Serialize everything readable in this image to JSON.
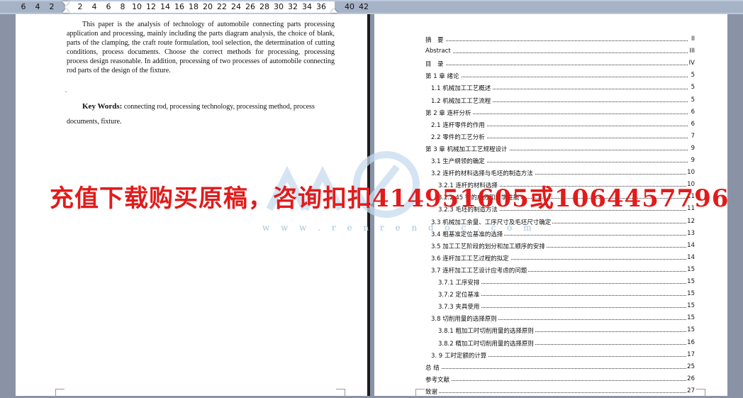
{
  "ruler": {
    "ticks": [
      "6",
      "4",
      "2",
      "2",
      "4",
      "6",
      "8",
      "10",
      "12",
      "14",
      "16",
      "18",
      "20",
      "22",
      "24",
      "26",
      "28",
      "30",
      "32",
      "34",
      "36",
      "40",
      "42"
    ]
  },
  "left_page": {
    "abstract_text": "This paper is the analysis of technology of automobile connecting parts processing application and processing, mainly including the parts diagram analysis, the choice of blank, parts of the clamping, the craft route formulation, tool selection, the determination of cutting conditions, process documents. Choose the correct methods for processing, processing process design reasonable. In addition, processing of two processes of automobile connecting rod parts of the design of the fixture.",
    "para_mark": ".",
    "keywords_label": "Key Words:",
    "keywords_text": "connecting rod, processing technology, processing method, process documents, fixture."
  },
  "toc": [
    {
      "label": "摘　要",
      "page": "II"
    },
    {
      "label": "Abstract",
      "page": "III"
    },
    {
      "label": "目　录",
      "page": "IV"
    },
    {
      "label": "第 1 章  绪论",
      "page": "5"
    },
    {
      "label": "1.1  机械加工工艺概述",
      "page": "5"
    },
    {
      "label": "1.2 机械加工工艺流程",
      "page": "5"
    },
    {
      "label": "第 2 章  连杆分析",
      "page": "6"
    },
    {
      "label": "2.1  连杆零件的作用",
      "page": "6"
    },
    {
      "label": "2.2 零件的工艺分析",
      "page": "7"
    },
    {
      "label": "第 3 章   机械加工工艺规程设计",
      "page": "9"
    },
    {
      "label": "3.1  生产纲领的确定",
      "page": "9"
    },
    {
      "label": "3.2  连杆的材料选择与毛坯的制造方法",
      "page": "10"
    },
    {
      "label": "3.2.1 连杆的材料选择",
      "page": "10"
    },
    {
      "label": "3.2.2 45 钢的成分和力学性能",
      "page": "11"
    },
    {
      "label": "3.2.3 毛坯的制造方法",
      "page": "11"
    },
    {
      "label": "3.3  机械加工余量、工序尺寸及毛坯尺寸确定",
      "page": "12"
    },
    {
      "label": "3.4  粗基准定位基准的选择",
      "page": "13"
    },
    {
      "label": "3.5  加工工艺阶段的划分和加工顺序的安排",
      "page": "14"
    },
    {
      "label": "3.6  连杆加工工艺过程的拟定",
      "page": "14"
    },
    {
      "label": "3.7  连杆加工工艺设计应考虑的问题",
      "page": "15"
    },
    {
      "label": "3.7.1   工序安排",
      "page": "15"
    },
    {
      "label": "3.7.2   定位基准",
      "page": "15"
    },
    {
      "label": "3.7.3   夹具使用",
      "page": "15"
    },
    {
      "label": "3.8  切削用量的选择原则",
      "page": "15"
    },
    {
      "label": "3.8.1  粗加工时切削用量的选择原则",
      "page": "15"
    },
    {
      "label": "3.8.2  精加工时切削用量的选择原则",
      "page": "16"
    },
    {
      "label": "3. 9  工时定额的计算",
      "page": "17"
    },
    {
      "label": "总  结",
      "page": "25"
    },
    {
      "label": "参考文献",
      "page": "26"
    },
    {
      "label": "致谢",
      "page": "27"
    }
  ],
  "watermark": {
    "text": "充值下载购买原稿，咨询扣扣414951605或1064457796",
    "url": "w w w . r e n r e n d o c . c o m",
    "color": "#e21b1b"
  }
}
